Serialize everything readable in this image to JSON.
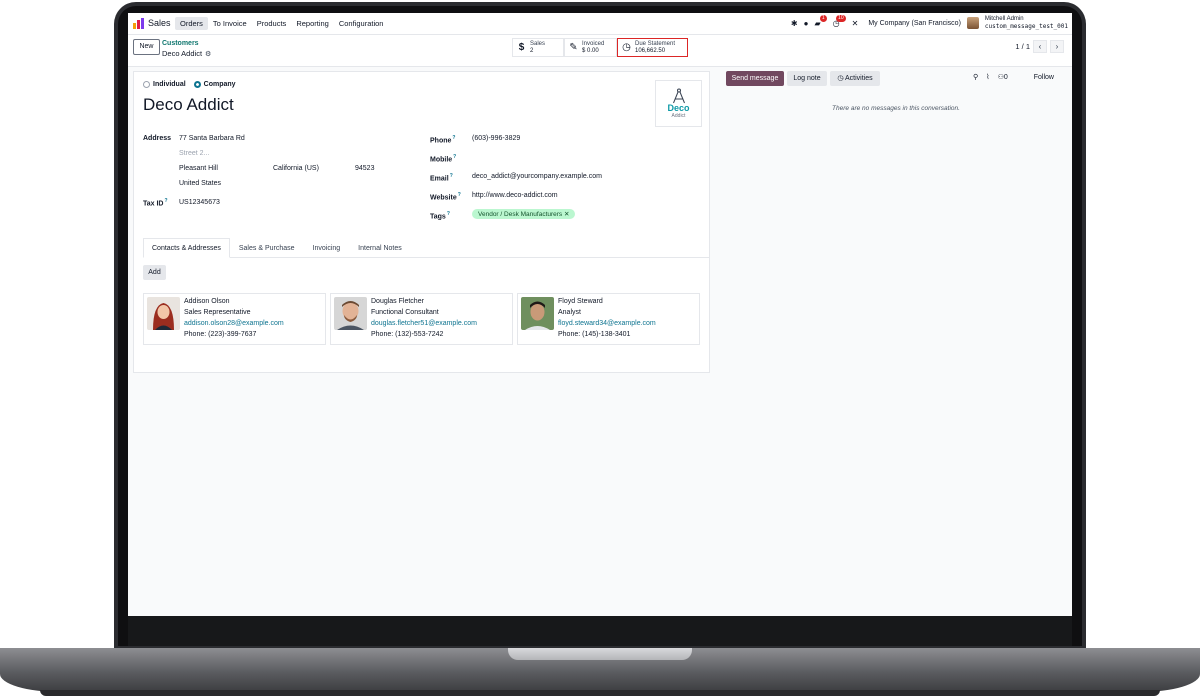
{
  "navbar": {
    "app_name": "Sales",
    "menu": [
      "Orders",
      "To Invoice",
      "Products",
      "Reporting",
      "Configuration"
    ],
    "messages_badge": "1",
    "activities_badge": "10",
    "company": "My Company (San Francisco)",
    "user_name": "Mitchell Admin",
    "database": "custom_message_test_001",
    "icons": [
      "bug-icon",
      "users-icon",
      "chat-icon",
      "clock-icon",
      "tools-icon"
    ]
  },
  "control": {
    "new_label": "New",
    "breadcrumb": "Customers",
    "record": "Deco Addict",
    "smart_buttons": [
      {
        "label": "Sales",
        "value": "2",
        "icon": "$"
      },
      {
        "label": "Invoiced",
        "value": "$ 0.00",
        "icon": "✎"
      },
      {
        "label": "Due Statement",
        "value": "106,662.50",
        "icon": "◷"
      }
    ],
    "pager": "1 / 1"
  },
  "form": {
    "type_individual": "Individual",
    "type_company": "Company",
    "name": "Deco Addict",
    "logo_word": "Deco",
    "logo_sub": "Addict",
    "address_label": "Address",
    "street": "77 Santa Barbara Rd",
    "street2_placeholder": "Street 2...",
    "city": "Pleasant Hill",
    "state": "California (US)",
    "zip": "94523",
    "country": "United States",
    "tax_label": "Tax ID",
    "tax_id": "US12345673",
    "phone_label": "Phone",
    "phone": "(603)-996-3829",
    "mobile_label": "Mobile",
    "email_label": "Email",
    "email": "deco_addict@yourcompany.example.com",
    "website_label": "Website",
    "website": "http://www.deco-addict.com",
    "tags_label": "Tags",
    "tag": "Vendor / Desk Manufacturers",
    "help_mark": "?"
  },
  "tabs": [
    "Contacts & Addresses",
    "Sales & Purchase",
    "Invoicing",
    "Internal Notes"
  ],
  "add_label": "Add",
  "contacts": [
    {
      "name": "Addison Olson",
      "role": "Sales Representative",
      "email": "addison.olson28@example.com",
      "phone": "Phone: (223)-399-7637"
    },
    {
      "name": "Douglas Fletcher",
      "role": "Functional Consultant",
      "email": "douglas.fletcher51@example.com",
      "phone": "Phone: (132)-553-7242"
    },
    {
      "name": "Floyd Steward",
      "role": "Analyst",
      "email": "floyd.steward34@example.com",
      "phone": "Phone: (145)-138-3401"
    }
  ],
  "chatter": {
    "send_message": "Send message",
    "log_note": "Log note",
    "activities": "Activities",
    "attachments_count": "0",
    "follow": "Follow",
    "empty": "There are no messages in this conversation."
  },
  "colors": {
    "primary": "#71485f",
    "link": "#0e7490",
    "highlight": "#dc2626",
    "tag_bg": "#bbf7d0"
  }
}
